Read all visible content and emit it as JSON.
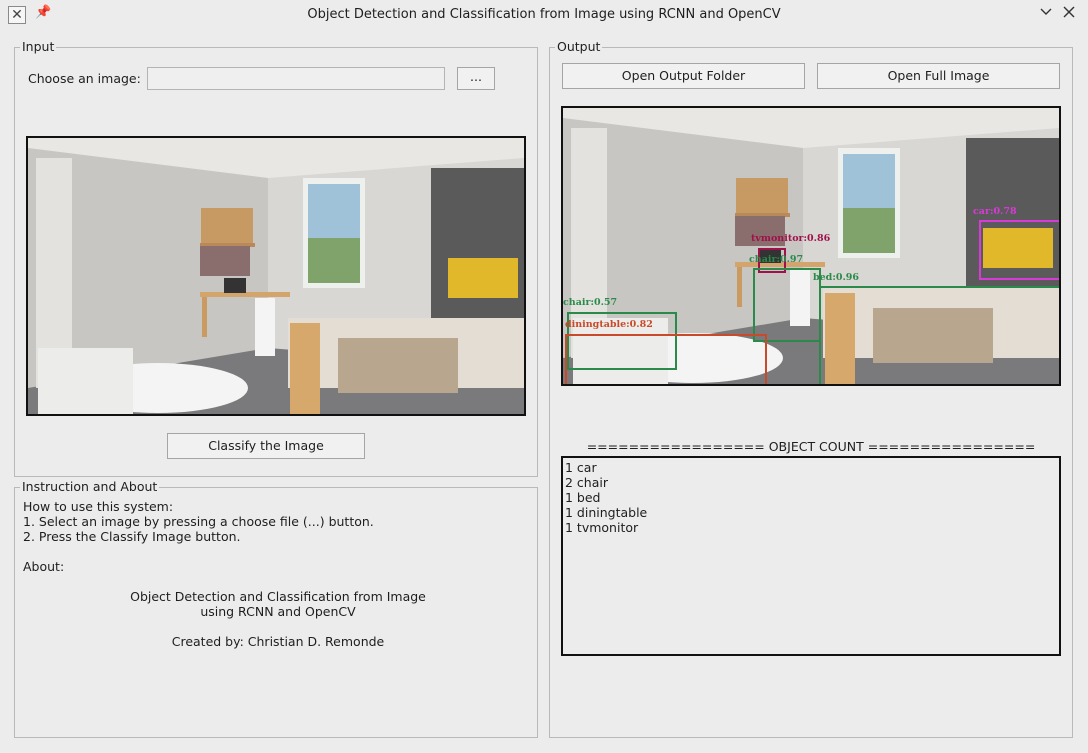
{
  "window": {
    "title": "Object Detection and Classification from Image using RCNN and OpenCV",
    "app_icon": "x-icon",
    "pin_icon": "pin-icon",
    "minimize_icon": "chevron-down-icon",
    "close_icon": "close-icon"
  },
  "input": {
    "legend": "Input",
    "choose_label": "Choose an image:",
    "file_value": "",
    "browse_label": "...",
    "classify_label": "Classify the Image"
  },
  "instructions": {
    "legend": "Instruction and About",
    "line1": "How to use this system:",
    "line2": "1. Select an image by pressing a choose file (...) button.",
    "line3": "2. Press the Classify Image button.",
    "line4": "About:",
    "about_title_1": "Object Detection and Classification from Image",
    "about_title_2": "using RCNN and OpenCV",
    "created_by": "Created by: Christian D. Remonde"
  },
  "output": {
    "legend": "Output",
    "open_folder_label": "Open Output Folder",
    "open_full_label": "Open Full Image",
    "detections": [
      {
        "label": "car:0.78",
        "color": "#d83ad8"
      },
      {
        "label": "tvmonitor:0.86",
        "color": "#a0104a"
      },
      {
        "label": "chair:0.97",
        "color": "#2a8a4a"
      },
      {
        "label": "bed:0.96",
        "color": "#2a8a4a"
      },
      {
        "label": "chair:0.57",
        "color": "#2a8a4a"
      },
      {
        "label": "diningtable:0.82",
        "color": "#c84a2a"
      }
    ],
    "count_header": "================= OBJECT COUNT ================",
    "counts": [
      "1 car",
      "2 chair",
      "1 bed",
      "1 diningtable",
      "1 tvmonitor"
    ]
  }
}
